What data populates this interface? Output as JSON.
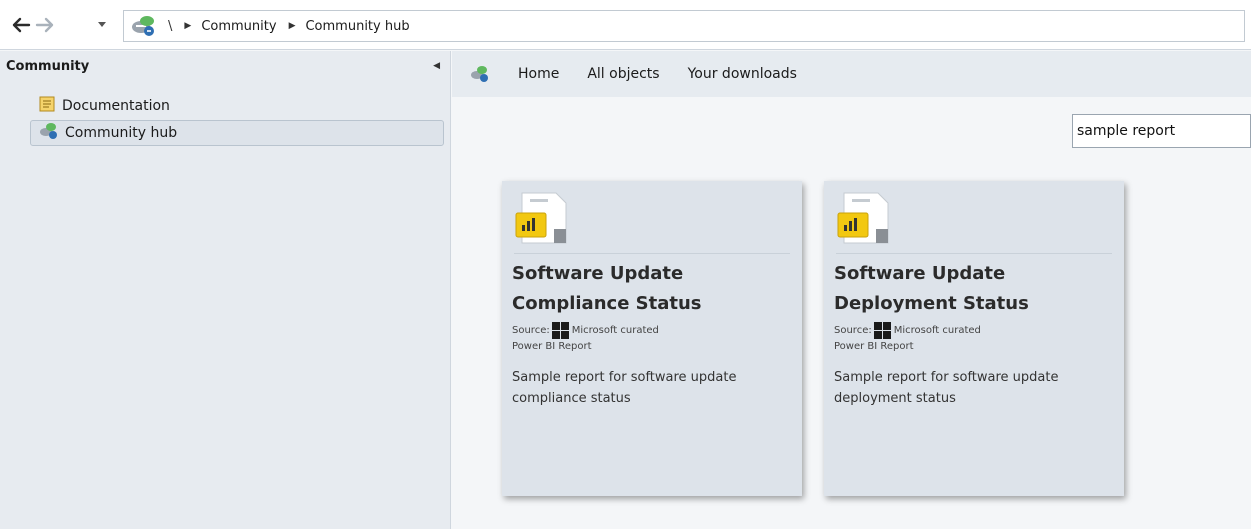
{
  "breadcrumb": {
    "root_separator": "\\",
    "items": [
      "Community",
      "Community hub"
    ]
  },
  "left_panel": {
    "title": "Community",
    "items": [
      {
        "label": "Documentation",
        "icon": "documentation-icon"
      },
      {
        "label": "Community hub",
        "icon": "community-hub-icon",
        "selected": true
      }
    ]
  },
  "top_nav": {
    "links": [
      "Home",
      "All objects",
      "Your downloads"
    ]
  },
  "search": {
    "value": "sample report"
  },
  "cards": [
    {
      "title": "Software Update Compliance Status",
      "source_label": "Source:",
      "source": "Microsoft curated",
      "type": "Power BI Report",
      "description": "Sample report for software update compliance status",
      "icon": "power-bi-report-icon"
    },
    {
      "title": "Software Update Deployment Status",
      "source_label": "Source:",
      "source": "Microsoft curated",
      "type": "Power BI Report",
      "description": "Sample report for software update deployment status",
      "icon": "power-bi-report-icon"
    }
  ],
  "colors": {
    "accent_green": "#5fb85f",
    "accent_blue": "#2f6fb3",
    "powerbi_yellow": "#f2c811"
  }
}
